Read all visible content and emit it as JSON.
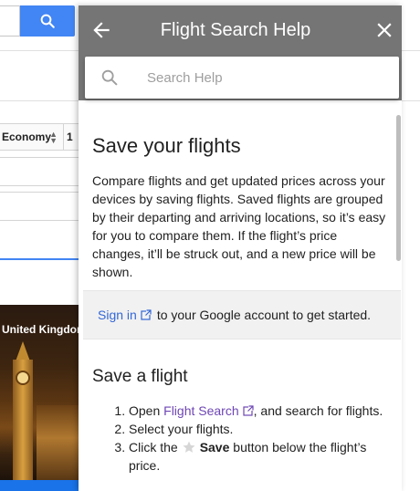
{
  "background": {
    "passenger_count": "1",
    "cabin_class": "Economy",
    "destination_card_title": "United Kingdom"
  },
  "help_panel": {
    "title": "Flight Search Help",
    "search": {
      "placeholder": "Search Help",
      "value": ""
    },
    "section_save_flights": {
      "heading": "Save your flights",
      "body": "Compare flights and get updated prices across your devices by saving flights. Saved flights are grouped by their departing and arriving locations, so it’s easy for you to compare them. If the flight’s price changes, it’ll be struck out, and a new price will be shown."
    },
    "signin_prompt": {
      "link": "Sign in",
      "rest": "to your Google account to get started."
    },
    "section_save_a_flight": {
      "heading": "Save a flight",
      "step1_prefix": "Open",
      "step1_link": "Flight Search",
      "step1_suffix": ", and search for flights.",
      "step2": "Select your flights.",
      "step3_prefix": "Click the",
      "step3_bold": "Save",
      "step3_suffix": "button below the flight’s price."
    }
  },
  "colors": {
    "header_bg": "#757575",
    "link_blue": "#3367d6",
    "link_purple": "#6e46b5",
    "search_button_blue": "#4285f4",
    "signin_bg": "#f1f1f1"
  },
  "icons": [
    "search-icon",
    "back-arrow-icon",
    "close-icon",
    "external-link-icon",
    "star-icon"
  ]
}
